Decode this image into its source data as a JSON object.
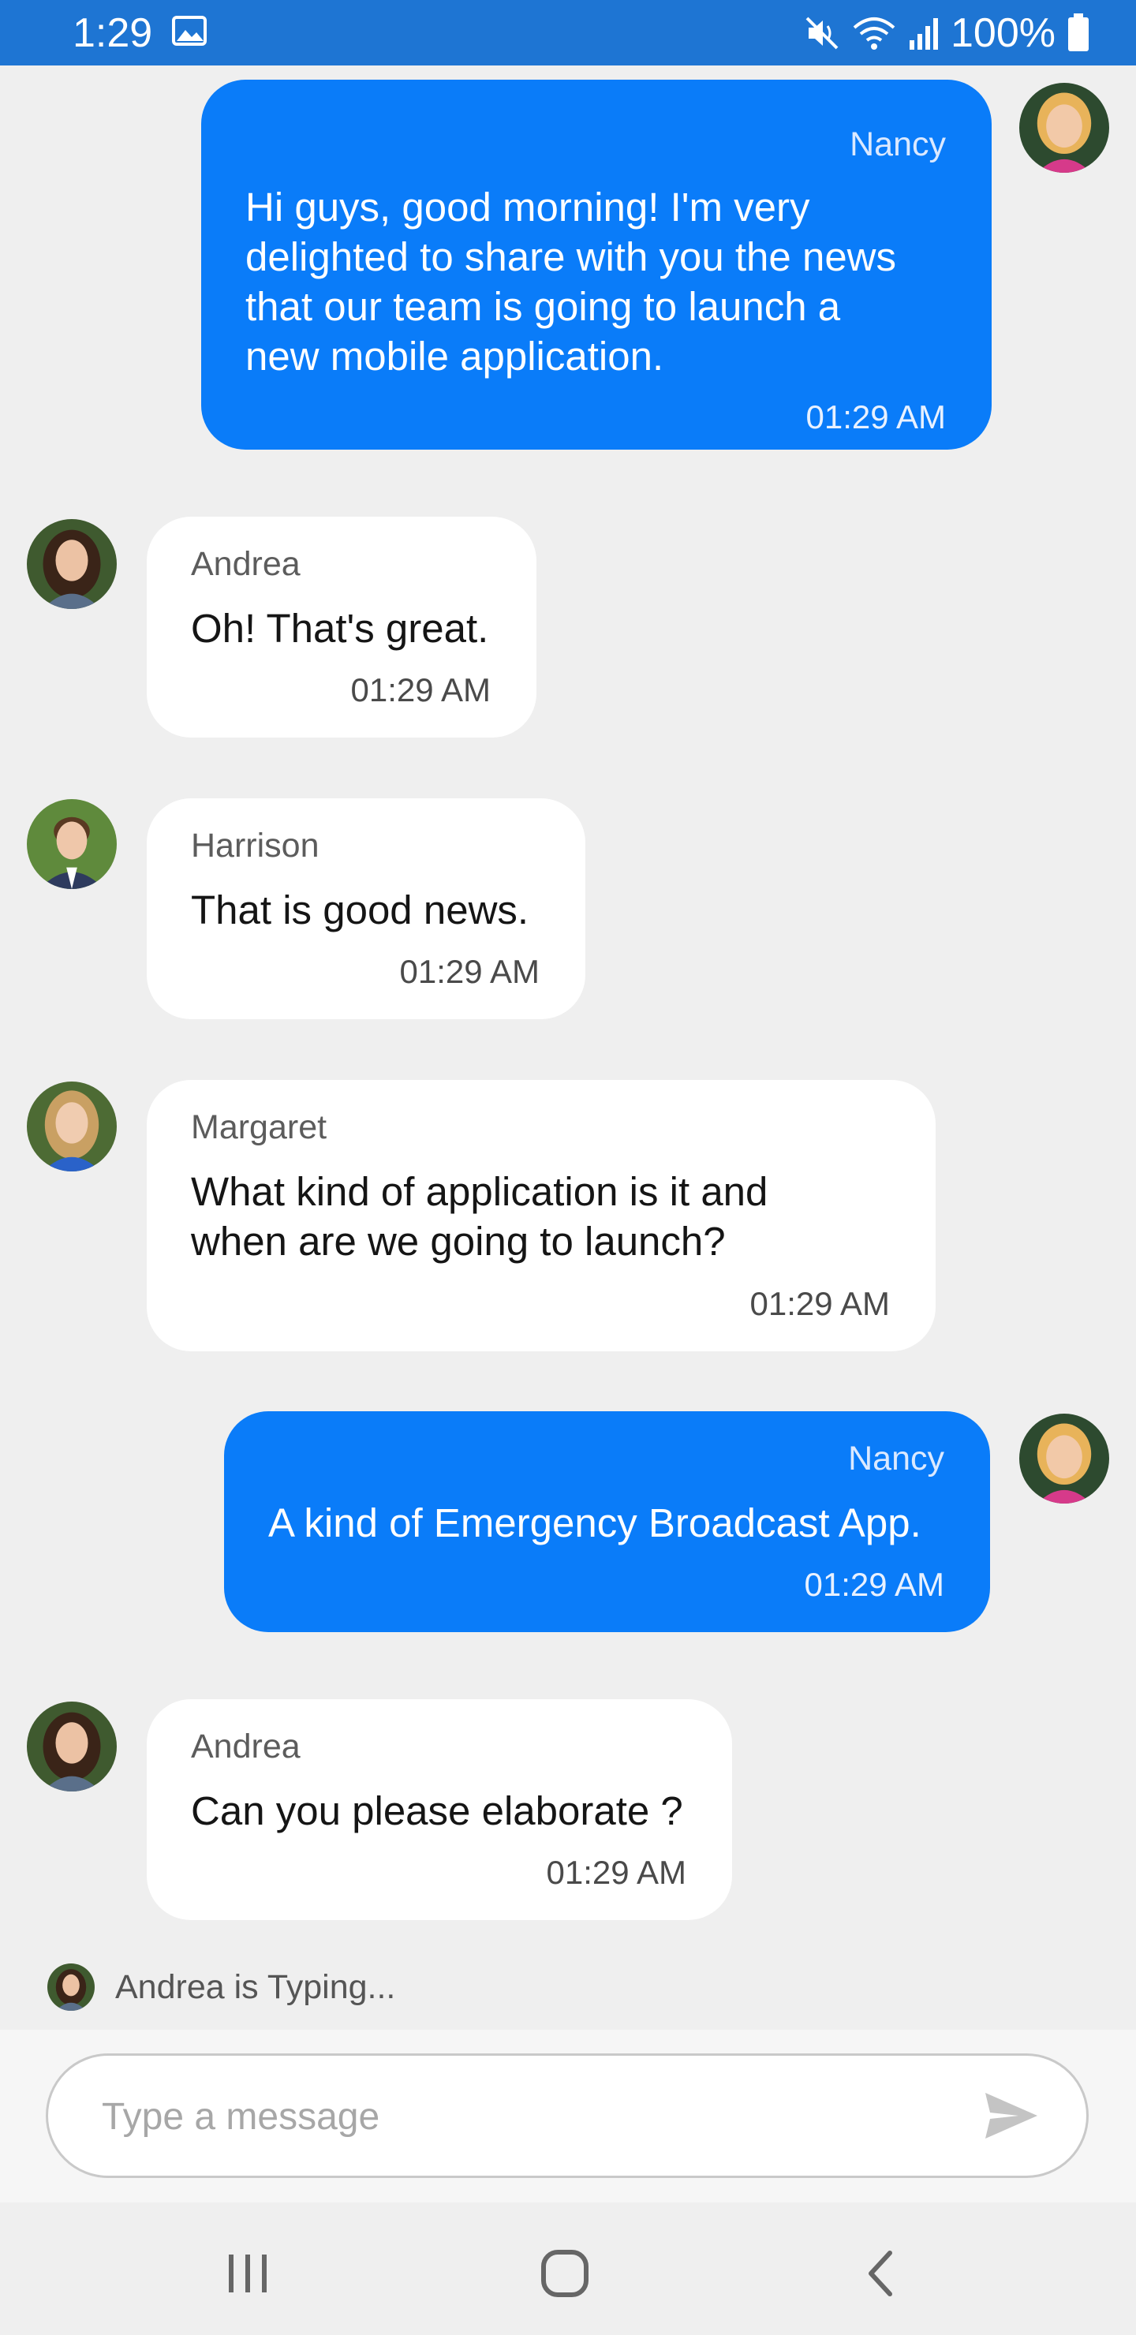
{
  "status": {
    "time": "1:29",
    "battery": "100%",
    "icons": [
      "gallery-icon",
      "mute-icon",
      "wifi-icon",
      "signal-icon",
      "battery-icon"
    ]
  },
  "messages": [
    {
      "author": "Nancy",
      "text": "Hi guys, good morning! I'm very\ndelighted to share with you the news\nthat our team is going to launch a\nnew mobile application.",
      "time": "01:29 AM",
      "outgoing": true
    },
    {
      "author": "Andrea",
      "text": "Oh! That's great.",
      "time": "01:29 AM",
      "outgoing": false
    },
    {
      "author": "Harrison",
      "text": "That is good news.",
      "time": "01:29 AM",
      "outgoing": false
    },
    {
      "author": "Margaret",
      "text": "What kind of application is it and\nwhen are we going to launch?",
      "time": "01:29 AM",
      "outgoing": false
    },
    {
      "author": "Nancy",
      "text": "A kind of Emergency Broadcast App.",
      "time": "01:29 AM",
      "outgoing": true
    },
    {
      "author": "Andrea",
      "text": "Can you please elaborate ?",
      "time": "01:29 AM",
      "outgoing": false
    }
  ],
  "typing": {
    "text": "Andrea is Typing..."
  },
  "composer": {
    "placeholder": "Type a message",
    "value": ""
  },
  "colors": {
    "statusbar": "#1e75d3",
    "outgoing_bubble": "#0a7cf9",
    "incoming_bubble": "#ffffff",
    "background": "#efefef"
  }
}
